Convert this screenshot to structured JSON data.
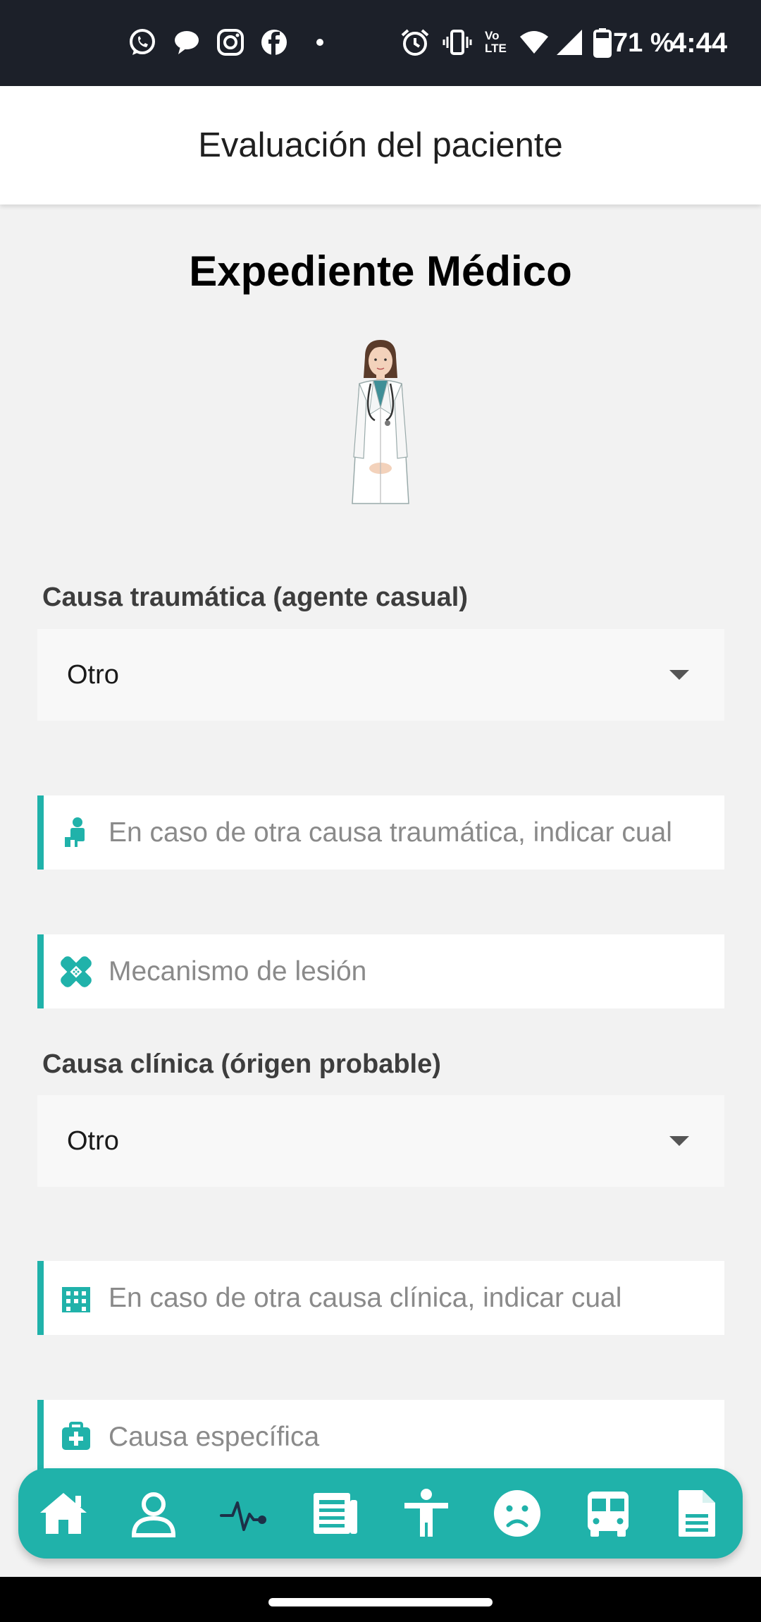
{
  "status_bar": {
    "battery": "71 %",
    "time": "4:44",
    "volte_label": "Vo LTE",
    "left_icons": [
      "whatsapp-icon",
      "chat-bubble-icon",
      "instagram-icon",
      "facebook-icon",
      "dot-icon"
    ],
    "right_icons": [
      "alarm-icon",
      "vibrate-icon",
      "volte-icon",
      "wifi-icon",
      "signal-icon",
      "battery-icon"
    ]
  },
  "app_bar": {
    "title": "Evaluación del paciente"
  },
  "main": {
    "heading": "Expediente Médico",
    "image": "doctor-illustration",
    "traumatic_cause": {
      "label": "Causa traumática (agente casual)",
      "selected": "Otro"
    },
    "other_traumatic_input": {
      "placeholder": "En caso de otra causa traumática, indicar cual",
      "value": "",
      "icon": "person-icon"
    },
    "injury_mechanism_input": {
      "placeholder": "Mecanismo de lesión",
      "value": "",
      "icon": "bandage-icon"
    },
    "clinical_cause": {
      "label": "Causa clínica (órigen probable)",
      "selected": "Otro"
    },
    "other_clinical_input": {
      "placeholder": "En caso de otra causa clínica, indicar cual",
      "value": "",
      "icon": "hospital-building-icon"
    },
    "specific_cause_input": {
      "placeholder": "Causa específica",
      "value": "",
      "icon": "medkit-icon"
    }
  },
  "bottom_nav": {
    "items": [
      "home-icon",
      "user-icon",
      "heartbeat-icon",
      "newspaper-icon",
      "body-icon",
      "sad-face-icon",
      "bus-icon",
      "document-icon"
    ],
    "active": "heartbeat-icon"
  },
  "colors": {
    "accent": "#20b2aa",
    "status_bar": "#1c2029",
    "background": "#f2f2f2",
    "active_icon": "#1c3048"
  }
}
